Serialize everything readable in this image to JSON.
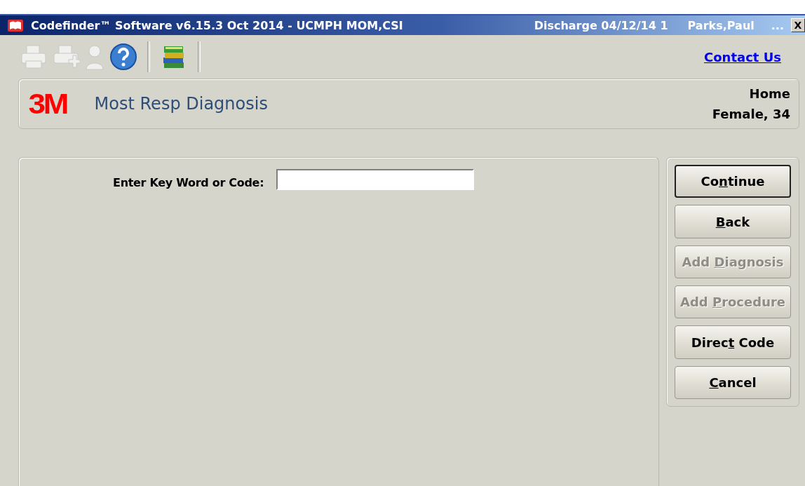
{
  "window": {
    "title": "Codefinder™ Software v6.15.3 Oct 2014 - UCMPH MOM,CSI",
    "discharge": "Discharge 04/12/14 1",
    "patient": "Parks,Paul",
    "overflow": "...",
    "close": "X"
  },
  "toolbar": {
    "items": [
      {
        "kind": "printer",
        "disabled": true
      },
      {
        "kind": "printer-add",
        "disabled": true
      },
      {
        "kind": "person",
        "disabled": true
      },
      {
        "kind": "help",
        "disabled": false
      },
      {
        "kind": "separator"
      },
      {
        "kind": "books",
        "disabled": false
      },
      {
        "kind": "separator"
      }
    ],
    "link": "Contact Us"
  },
  "header": {
    "logo": "3M",
    "title": "Most Resp Diagnosis",
    "location": "Home",
    "demographics": "Female, 34"
  },
  "form": {
    "label": "Enter Key Word or Code:"
  },
  "buttons": [
    {
      "before": "Co",
      "key": "n",
      "after": "tinue",
      "disabled": false,
      "selected": true
    },
    {
      "key": "B",
      "after": "ack",
      "disabled": false,
      "selected": false
    },
    {
      "before": "Add ",
      "key": "D",
      "after": "iagnosis",
      "disabled": true,
      "selected": false
    },
    {
      "before": "Add ",
      "key": "P",
      "after": "rocedure",
      "disabled": true,
      "selected": false
    },
    {
      "before": "Direc",
      "key": "t",
      "after": " Code",
      "disabled": false,
      "selected": false
    },
    {
      "key": "C",
      "after": "ancel",
      "disabled": false,
      "selected": false
    }
  ]
}
